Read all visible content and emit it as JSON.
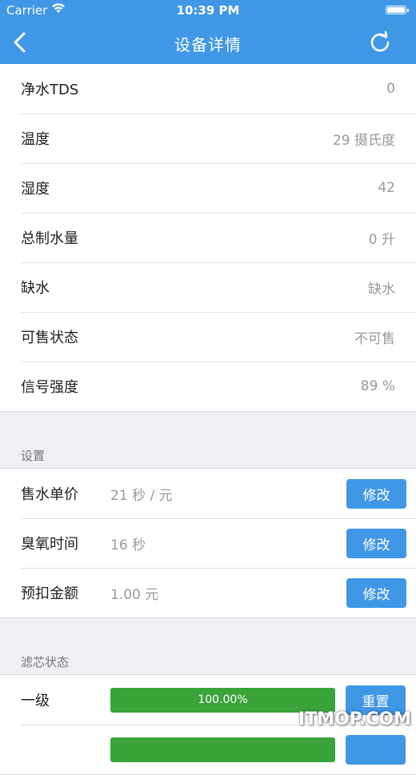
{
  "status_bar": {
    "carrier": "Carrier",
    "wifi_icon": "wifi-icon",
    "time": "10:39 PM",
    "battery_icon": "battery-full-icon"
  },
  "nav": {
    "title": "设备详情",
    "back_icon": "chevron-left-icon",
    "refresh_icon": "refresh-icon",
    "color": "#3f97e6"
  },
  "details": [
    {
      "label": "净水TDS",
      "value": "0"
    },
    {
      "label": "温度",
      "value": "29 摄氏度"
    },
    {
      "label": "湿度",
      "value": "42"
    },
    {
      "label": "总制水量",
      "value": "0 升"
    },
    {
      "label": "缺水",
      "value": "缺水"
    },
    {
      "label": "可售状态",
      "value": "不可售"
    },
    {
      "label": "信号强度",
      "value": "89 %"
    }
  ],
  "settings": {
    "header": "设置",
    "rows": [
      {
        "label": "售水单价",
        "value": "21 秒 / 元",
        "button": "修改"
      },
      {
        "label": "臭氧时间",
        "value": "16 秒",
        "button": "修改"
      },
      {
        "label": "预扣金额",
        "value": "1.00 元",
        "button": "修改"
      }
    ]
  },
  "filters": {
    "header": "滤芯状态",
    "rows": [
      {
        "label": "一级",
        "percent": "100.00%",
        "fraction": 1.0,
        "button": "重置"
      },
      {
        "label": "",
        "percent": "",
        "fraction": 1.0,
        "button": ""
      }
    ],
    "bar_color": "#3aa33a"
  },
  "watermark": "ITMOP.COM"
}
